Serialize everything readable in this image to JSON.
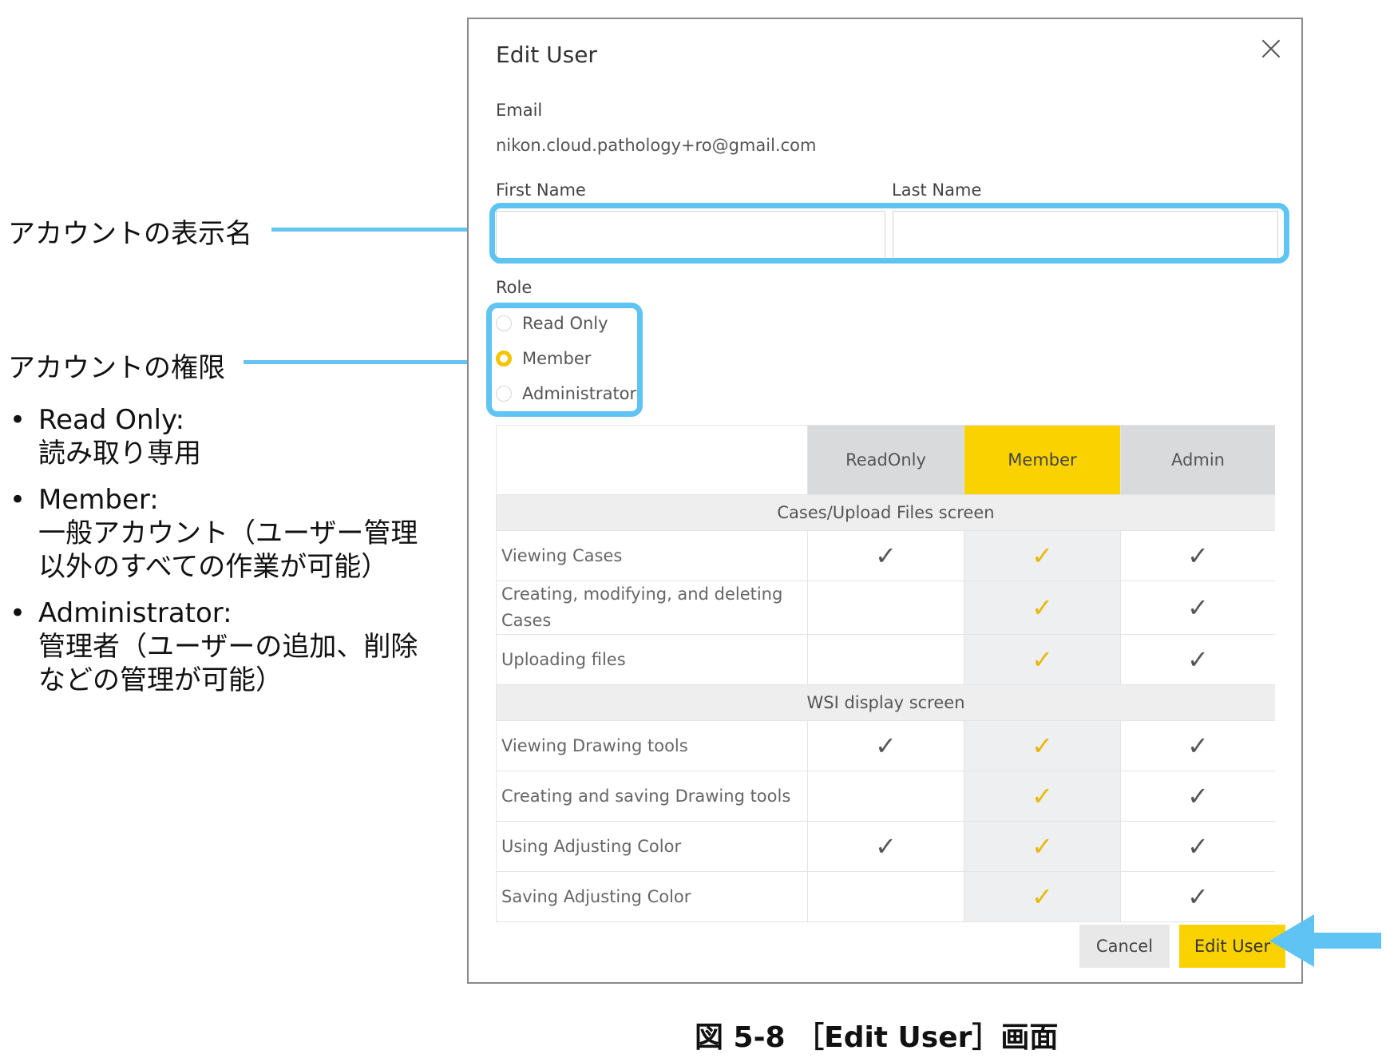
{
  "annotations": {
    "display_name": "アカウントの表示名",
    "permissions": "アカウントの権限",
    "bullets": [
      {
        "term": "Read Only:",
        "desc": "読み取り専用"
      },
      {
        "term": "Member:",
        "desc": "一般アカウント（ユーザー管理\n以外のすべての作業が可能）"
      },
      {
        "term": "Administrator:",
        "desc": "管理者（ユーザーの追加、削除\nなどの管理が可能）"
      }
    ],
    "bullet_symbol": "•",
    "highlight_color": "#5fc3f3"
  },
  "dialog": {
    "title": "Edit User",
    "email_label": "Email",
    "email_value": "nikon.cloud.pathology+ro@gmail.com",
    "first_name_label": "First Name",
    "last_name_label": "Last Name",
    "first_name_value": "",
    "last_name_value": "",
    "role_label": "Role",
    "roles": [
      {
        "label": "Read Only",
        "checked": false
      },
      {
        "label": "Member",
        "checked": true
      },
      {
        "label": "Administrator",
        "checked": false
      }
    ],
    "accent_color": "#fad200"
  },
  "table": {
    "columns": [
      "ReadOnly",
      "Member",
      "Admin"
    ],
    "check_glyph": "✓",
    "sections": [
      {
        "title": "Cases/Upload Files screen",
        "rows": [
          {
            "feature": "Viewing Cases",
            "readonly": true,
            "member": true,
            "admin": true
          },
          {
            "feature": "Creating, modifying, and deleting Cases",
            "readonly": false,
            "member": true,
            "admin": true
          },
          {
            "feature": "Uploading files",
            "readonly": false,
            "member": true,
            "admin": true
          }
        ]
      },
      {
        "title": "WSI display screen",
        "rows": [
          {
            "feature": "Viewing Drawing tools",
            "readonly": true,
            "member": true,
            "admin": true
          },
          {
            "feature": "Creating and saving Drawing tools",
            "readonly": false,
            "member": true,
            "admin": true
          },
          {
            "feature": "Using Adjusting Color",
            "readonly": true,
            "member": true,
            "admin": true
          },
          {
            "feature": "Saving Adjusting Color",
            "readonly": false,
            "member": true,
            "admin": true
          }
        ]
      }
    ]
  },
  "buttons": {
    "cancel": "Cancel",
    "edit_user": "Edit User"
  },
  "caption": "図 5-8 ［Edit User］画面"
}
